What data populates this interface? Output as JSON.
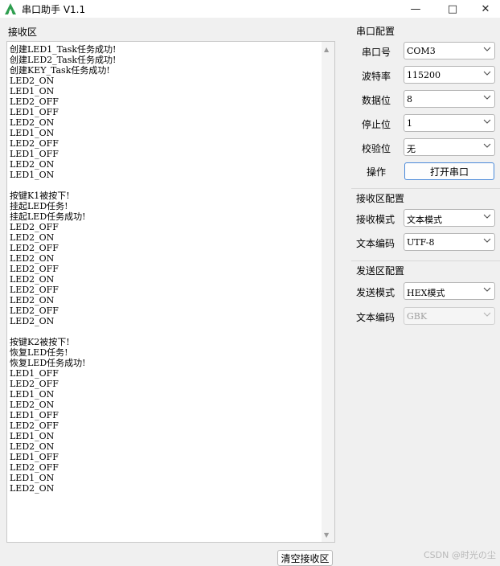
{
  "window": {
    "title": "串口助手 V1.1"
  },
  "receive": {
    "label": "接收区",
    "lines": [
      "创建LED1_Task任务成功!",
      "创建LED2_Task任务成功!",
      "创建KEY_Task任务成功!",
      "LED2_ON",
      "LED1_ON",
      "LED2_OFF",
      "LED1_OFF",
      "LED2_ON",
      "LED1_ON",
      "LED2_OFF",
      "LED1_OFF",
      "LED2_ON",
      "LED1_ON",
      "",
      "按键K1被按下!",
      "挂起LED任务!",
      "挂起LED任务成功!",
      "LED2_OFF",
      "LED2_ON",
      "LED2_OFF",
      "LED2_ON",
      "LED2_OFF",
      "LED2_ON",
      "LED2_OFF",
      "LED2_ON",
      "LED2_OFF",
      "LED2_ON",
      "",
      "按键K2被按下!",
      "恢复LED任务!",
      "恢复LED任务成功!",
      "LED1_OFF",
      "LED2_OFF",
      "LED1_ON",
      "LED2_ON",
      "LED1_OFF",
      "LED2_OFF",
      "LED1_ON",
      "LED2_ON",
      "LED1_OFF",
      "LED2_OFF",
      "LED1_ON",
      "LED2_ON"
    ],
    "clear_label": "清空接收区"
  },
  "serial_config": {
    "title": "串口配置",
    "port": {
      "label": "串口号",
      "value": "COM3"
    },
    "baud": {
      "label": "波特率",
      "value": "115200"
    },
    "databits": {
      "label": "数据位",
      "value": "8"
    },
    "stopbits": {
      "label": "停止位",
      "value": "1"
    },
    "parity": {
      "label": "校验位",
      "value": "无"
    },
    "action": {
      "label": "操作",
      "button": "打开串口"
    }
  },
  "receive_config": {
    "title": "接收区配置",
    "mode": {
      "label": "接收模式",
      "value": "文本模式"
    },
    "encoding": {
      "label": "文本编码",
      "value": "UTF-8"
    }
  },
  "send_config": {
    "title": "发送区配置",
    "mode": {
      "label": "发送模式",
      "value": "HEX模式"
    },
    "encoding": {
      "label": "文本编码",
      "value": "GBK"
    }
  },
  "watermark": "CSDN @时光の尘",
  "colors": {
    "accent": "#4a89d9",
    "icon_green": "#2e9e4f"
  },
  "icons": [
    "app-icon",
    "minimize-icon",
    "maximize-icon",
    "close-icon",
    "chevron-down-icon",
    "scroll-up-icon",
    "scroll-down-icon"
  ]
}
